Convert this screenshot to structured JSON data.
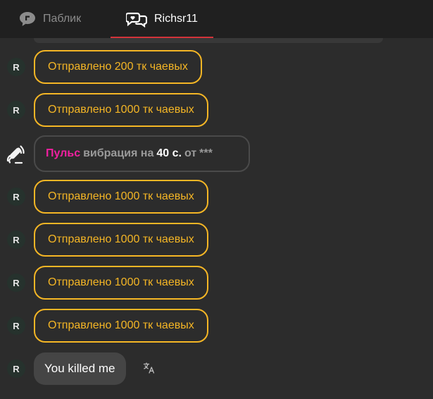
{
  "tabs": [
    {
      "label": "Паблик",
      "icon": "chat-bubble-icon",
      "active": false
    },
    {
      "label": "Richsr11",
      "icon": "private-chat-icon",
      "active": true
    }
  ],
  "colors": {
    "accent": "#d3333a",
    "tip": "#f5b625",
    "pulse": "#f020a0"
  },
  "messages": [
    {
      "type": "tip",
      "avatar": "R",
      "text": "Отправлено 200 тк чаевых"
    },
    {
      "type": "tip",
      "avatar": "R",
      "text": "Отправлено 1000 тк чаевых"
    },
    {
      "type": "pulse",
      "icon": "vibration-icon",
      "pulse_word": "Пульс",
      "middle": "вибрация на",
      "duration": "40 с.",
      "from_label": "от",
      "sender": "***"
    },
    {
      "type": "tip",
      "avatar": "R",
      "text": "Отправлено 1000 тк чаевых"
    },
    {
      "type": "tip",
      "avatar": "R",
      "text": "Отправлено 1000 тк чаевых"
    },
    {
      "type": "tip",
      "avatar": "R",
      "text": "Отправлено 1000 тк чаевых"
    },
    {
      "type": "tip",
      "avatar": "R",
      "text": "Отправлено 1000 тк чаевых"
    },
    {
      "type": "text",
      "avatar": "R",
      "text": "You killed me",
      "action_icon": "translate-icon"
    }
  ]
}
